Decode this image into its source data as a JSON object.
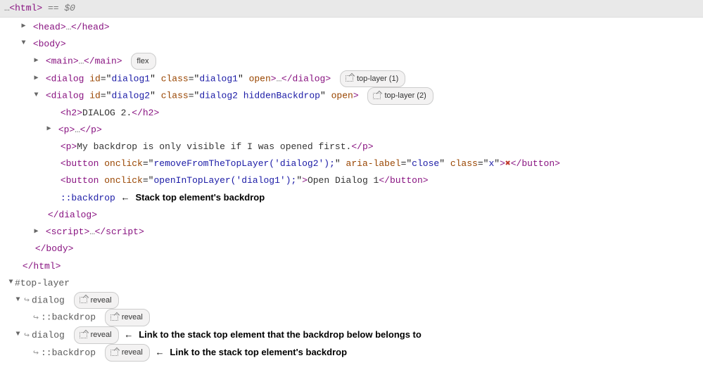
{
  "header": {
    "dots": "…",
    "tag": "html",
    "eq": " == ",
    "var": "$0"
  },
  "glyphs": {
    "dots": "…",
    "cross": "✖",
    "link": "↪",
    "left_arrow": "←"
  },
  "badges": {
    "flex": "flex",
    "top_layer_1": "top-layer (1)",
    "top_layer_2": "top-layer (2)",
    "reveal": "reveal"
  },
  "tags": {
    "head": "head",
    "body": "body",
    "main": "main",
    "dialog": "dialog",
    "h2": "h2",
    "p": "p",
    "button": "button",
    "script": "script",
    "html": "html"
  },
  "attrs": {
    "id": "id",
    "class": "class",
    "open": "open",
    "onclick": "onclick",
    "aria_label": "aria-label"
  },
  "vals": {
    "dialog1_id": "dialog1",
    "dialog1_class": "dialog1",
    "dialog2_id": "dialog2",
    "dialog2_class": "dialog2 hiddenBackdrop",
    "onclick_remove": "removeFromTheTopLayer('dialog2');",
    "onclick_open": "openInTopLayer('dialog1');",
    "aria_close": "close",
    "x_class": "x"
  },
  "text": {
    "h2": "DIALOG 2.",
    "p_backdrop": "My backdrop is only visible if I was opened first.",
    "open_dialog_1": "Open Dialog 1"
  },
  "pseudo": {
    "backdrop": "::backdrop"
  },
  "anno": {
    "stack_top_backdrop": "Stack top element's backdrop",
    "link_to_stack_top": "Link to the stack top element that the backdrop below belongs to",
    "link_to_stack_backdrop": "Link to the stack top element's backdrop"
  },
  "top_layer": {
    "label": "#top-layer",
    "dialog": "dialog",
    "backdrop": "::backdrop"
  }
}
